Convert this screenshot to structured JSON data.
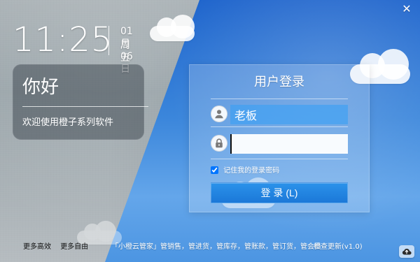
{
  "window": {
    "close_glyph": "✕"
  },
  "clock": {
    "time": "11:25",
    "date": "01月06日",
    "weekday": "周五"
  },
  "greeting": {
    "title": "你好",
    "subtitle": "欢迎使用橙子系列软件"
  },
  "login": {
    "title": "用户登录",
    "username_value": "老板",
    "password_value": "",
    "remember_label": "记住我的登录密码",
    "remember_checked": true,
    "button_label": "登 录 (L)"
  },
  "footer": {
    "left_items": [
      "更多高效",
      "更多自由"
    ],
    "center_text": "「小橙云管家」管销售，管进货，管库存，管账款，管订货，管会员",
    "update_text": "检查更新(v1.0)"
  },
  "icons": {
    "user_icon": "user-icon",
    "lock_icon": "lock-icon",
    "cloud_icon": "cloud-icon"
  },
  "colors": {
    "sky_top": "#1e64cc",
    "sky_bottom": "#4c95e2",
    "button": "#1b78d8"
  }
}
